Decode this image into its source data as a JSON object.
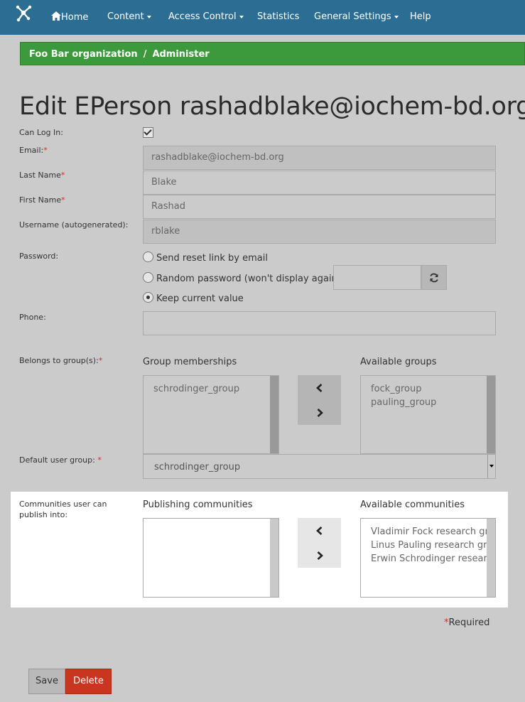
{
  "nav": {
    "logo": "molecule-icon",
    "items": [
      "Home",
      "Content",
      "Access Control",
      "Statistics",
      "General Settings",
      "Help"
    ]
  },
  "breadcrumb": {
    "org": "Foo Bar organization",
    "separator": "/",
    "current": "Administer"
  },
  "page_title": "Edit EPerson rashadblake@iochem-bd.org:",
  "form": {
    "can_log_in": {
      "label": "Can Log In:",
      "checked": true
    },
    "email": {
      "label": "Email:",
      "required_mark": "*",
      "value": "rashadblake@iochem-bd.org"
    },
    "last_name": {
      "label": "Last Name",
      "required_mark": "*",
      "value": "Blake"
    },
    "first_name": {
      "label": "First Name",
      "required_mark": "*",
      "value": "Rashad"
    },
    "username": {
      "label": "Username (autogenerated):",
      "value": "rblake"
    },
    "password": {
      "label": "Password:",
      "options": [
        "Send reset link by email",
        "Random password (won't display again)",
        "Keep current value"
      ],
      "selected": "Keep current value"
    },
    "phone": {
      "label": "Phone:",
      "value": ""
    },
    "groups": {
      "label": "Belongs to group(s):",
      "required_mark": "*",
      "memberships_title": "Group memberships",
      "memberships": [
        "schrodinger_group"
      ],
      "available_title": "Available groups",
      "available": [
        "fock_group",
        "pauling_group"
      ]
    },
    "default_group": {
      "label": "Default user group:",
      "required_mark": "*",
      "value": "schrodinger_group"
    },
    "communities": {
      "label_line1": "Communities user can",
      "label_line2": "publish into:",
      "publishing_title": "Publishing communities",
      "publishing": [],
      "available_title": "Available communities",
      "available": [
        "Vladimir Fock research group",
        "Linus Pauling research group",
        "Erwin Schrodinger research group"
      ]
    }
  },
  "required_note": {
    "mark": "*",
    "text": "Required"
  },
  "buttons": {
    "save": "Save",
    "delete": "Delete"
  },
  "colors": {
    "navbar": "#2c6e93",
    "breadcrumb": "#3c9a3c",
    "delete": "#c9351f",
    "required": "#c9302c"
  }
}
